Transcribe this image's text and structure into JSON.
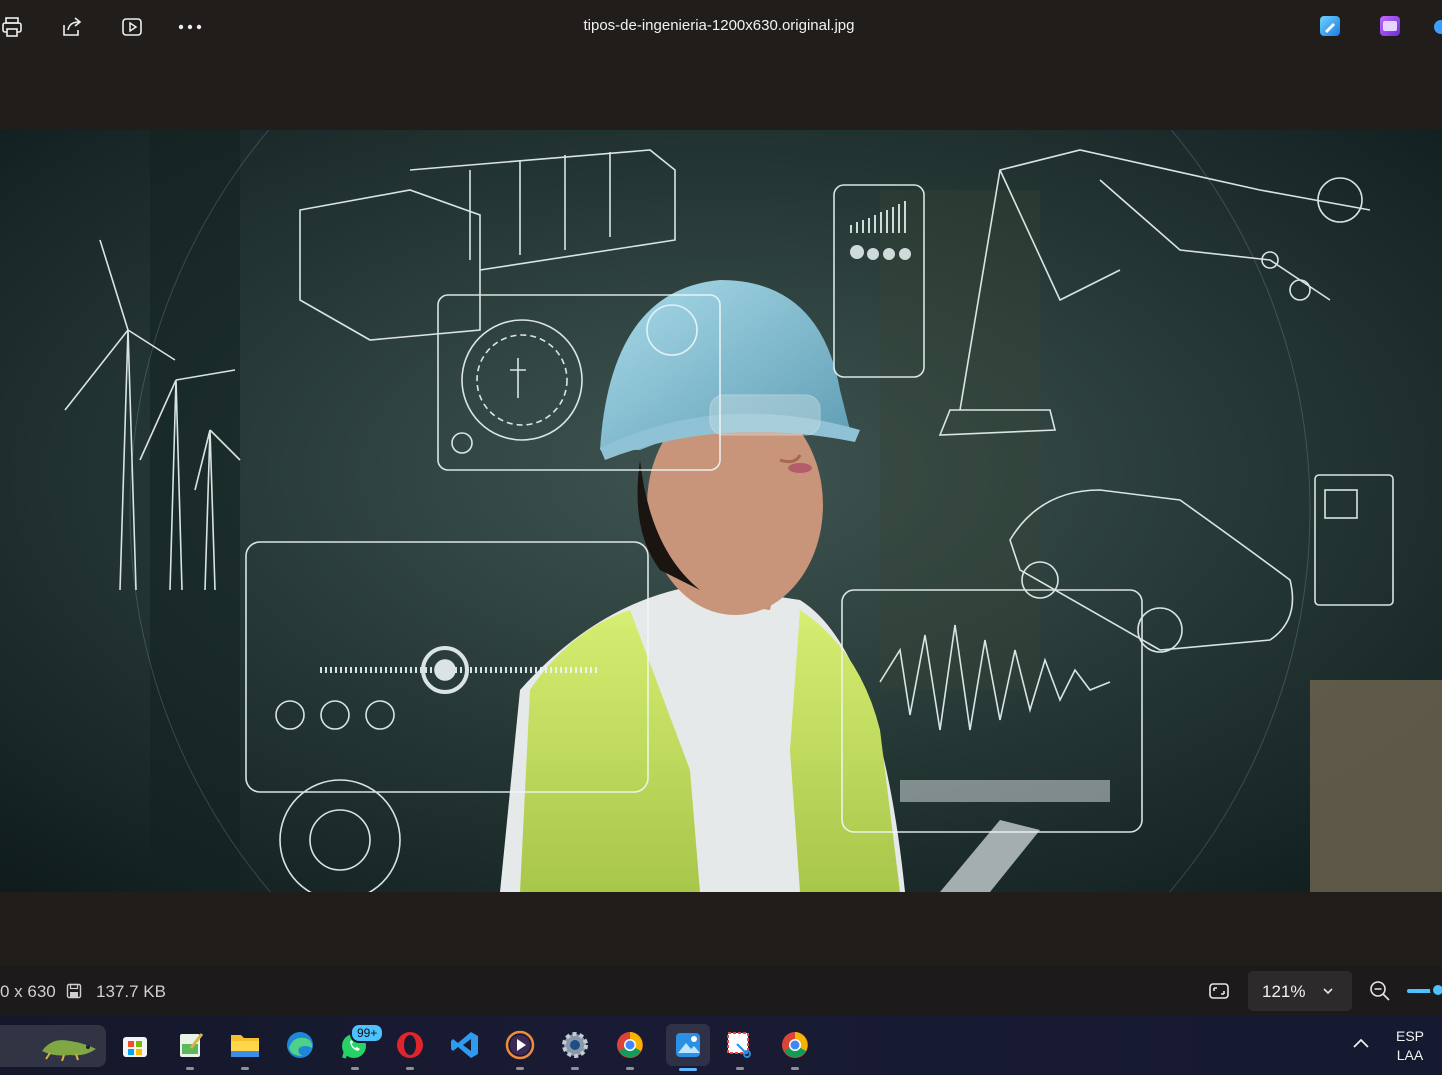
{
  "titlebar": {
    "filename": "tipos-de-ingenieria-1200x630.original.jpg",
    "buttons": [
      "print-icon",
      "share-icon",
      "slideshow-icon",
      "more-icon"
    ],
    "right_apps": [
      "clipchamp-edit-icon",
      "clipchamp-video-icon"
    ]
  },
  "status": {
    "dimensions": "0 x 630",
    "file_size": "137.7 KB",
    "zoom": "121%"
  },
  "taskbar": {
    "whatsapp_badge": "99+",
    "language": "ESP",
    "layout": "LAA",
    "apps": [
      "lizard-widget",
      "microsoft-store-icon",
      "notepad-icon",
      "file-explorer-icon",
      "edge-icon",
      "whatsapp-icon",
      "opera-icon",
      "vscode-icon",
      "media-player-icon",
      "settings-icon",
      "chrome-icon",
      "photos-icon",
      "snipping-tool-icon",
      "chrome-icon"
    ]
  },
  "colors": {
    "accent": "#4cc2ff",
    "background": "#201c1a"
  }
}
